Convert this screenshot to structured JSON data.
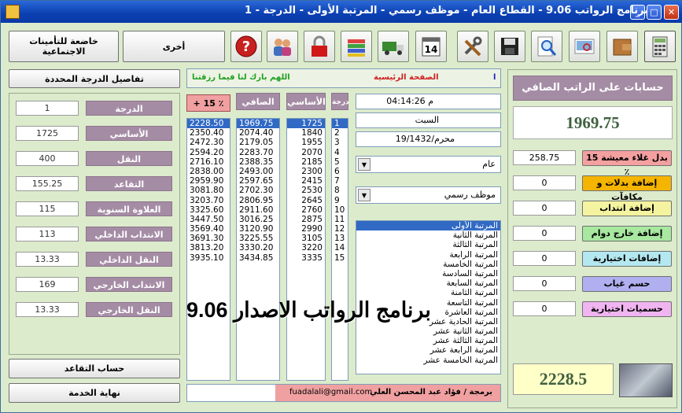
{
  "window": {
    "title": "برنامج الرواتب 9.06  -  القطاع العام  -  موظف رسمي  -  المرتبة الأولى  -  الدرجة  -  1",
    "controls": {
      "minimize": "_",
      "maximize": "□",
      "close": "✕"
    }
  },
  "toolbar": {
    "left_buttons": {
      "social": "خاضعة للتأمينات الاجتماعية",
      "other": "أخرى"
    },
    "icons": [
      "calculator-icon",
      "wallet-icon",
      "preview-icon",
      "search-icon",
      "save-icon",
      "tools-icon",
      "calendar-icon",
      "truck-icon",
      "books-icon",
      "lock-icon",
      "users-icon",
      "help-icon"
    ],
    "calendar_day": "14"
  },
  "left_panel": {
    "details_button": "تفاصيل الدرجة المحددة",
    "fields": [
      {
        "label": "الدرجة",
        "value": "1"
      },
      {
        "label": "الأساسي",
        "value": "1725"
      },
      {
        "label": "النقل",
        "value": "400"
      },
      {
        "label": "التقاعد",
        "value": "155.25"
      },
      {
        "label": "العلاوة السنوية",
        "value": "115"
      },
      {
        "label": "الانتداب الداخلي",
        "value": "113"
      },
      {
        "label": "النقل الداخلي",
        "value": "13.33"
      },
      {
        "label": "الانتداب الخارجي",
        "value": "169"
      },
      {
        "label": "النقل الخارجي",
        "value": "13.33"
      }
    ],
    "retirement_button": "حساب التقاعد",
    "end_service_button": "نهاية الخدمة"
  },
  "marquee": {
    "home": "الصفحة الرئيسية",
    "prayer": "اللهم بارك لنا فيما رزقتنا",
    "edge_char": "ا"
  },
  "table": {
    "headers": {
      "plus15": "+ 15 ٪",
      "net": "الصافي",
      "basic": "الأساسي",
      "grade": "درجة"
    },
    "plus15": [
      "2228.50",
      "2350.40",
      "2472.30",
      "2594.20",
      "2716.10",
      "2838.00",
      "2959.90",
      "3081.80",
      "3203.70",
      "3325.60",
      "3447.50",
      "3569.40",
      "3691.30",
      "3813.20",
      "3935.10"
    ],
    "net": [
      "1969.75",
      "2074.40",
      "2179.05",
      "2283.70",
      "2388.35",
      "2493.00",
      "2597.65",
      "2702.30",
      "2806.95",
      "2911.60",
      "3016.25",
      "3120.90",
      "3225.55",
      "3330.20",
      "3434.85"
    ],
    "basic": [
      "1725",
      "1840",
      "1955",
      "2070",
      "2185",
      "2300",
      "2415",
      "2530",
      "2645",
      "2760",
      "2875",
      "2990",
      "3105",
      "3220",
      "3335"
    ],
    "grade": [
      "1",
      "2",
      "3",
      "4",
      "5",
      "6",
      "7",
      "8",
      "9",
      "10",
      "11",
      "12",
      "13",
      "14",
      "15"
    ]
  },
  "info": {
    "time": "04:14:26 م",
    "day": "السبت",
    "date": "19/محرم/1432",
    "sector": "عام",
    "employee_type": "موظف رسمي",
    "ranks": [
      "المرتبة الأولى",
      "المرتبة الثانية",
      "المرتبة الثالثة",
      "المرتبة الرابعة",
      "المرتبة الخامسة",
      "المرتبة السادسة",
      "المرتبة السابعة",
      "المرتبة الثامنة",
      "المرتبة التاسعة",
      "المرتبة العاشرة",
      "المرتبة الحادية عشر",
      "المرتبة الثانية عشر",
      "المرتبة الثالثة عشر",
      "المرتبة الرابعة عشر",
      "المرتبة الخامسة عشر"
    ]
  },
  "overlay": {
    "text": "برنامج الرواتب الاصدار 9.06"
  },
  "footer": {
    "credit": "برمجة / فؤاد عبد المحسن العلي",
    "email": "fuadalali@gmail.com"
  },
  "right_panel": {
    "net_title": "حسابات على الراتب الصافي",
    "net_value": "1969.75",
    "rows": [
      {
        "label": "بدل غلاء معيشة 15 ٪",
        "value": "258.75",
        "color": "#f4a0a0"
      },
      {
        "label": "إضافة بدلات و مكافآت",
        "value": "0",
        "color": "#f5b400"
      },
      {
        "label": "إضافة انتداب",
        "value": "0",
        "color": "#f4f4a0"
      },
      {
        "label": "إضافة خارج دوام",
        "value": "0",
        "color": "#a8e8a0"
      },
      {
        "label": "إضافات اختيارية",
        "value": "0",
        "color": "#b4e8f0"
      },
      {
        "label": "حسم غياب",
        "value": "0",
        "color": "#b0b0f0"
      },
      {
        "label": "حسميات اختيارية",
        "value": "0",
        "color": "#f0b4f0"
      }
    ],
    "total": "2228.5"
  }
}
